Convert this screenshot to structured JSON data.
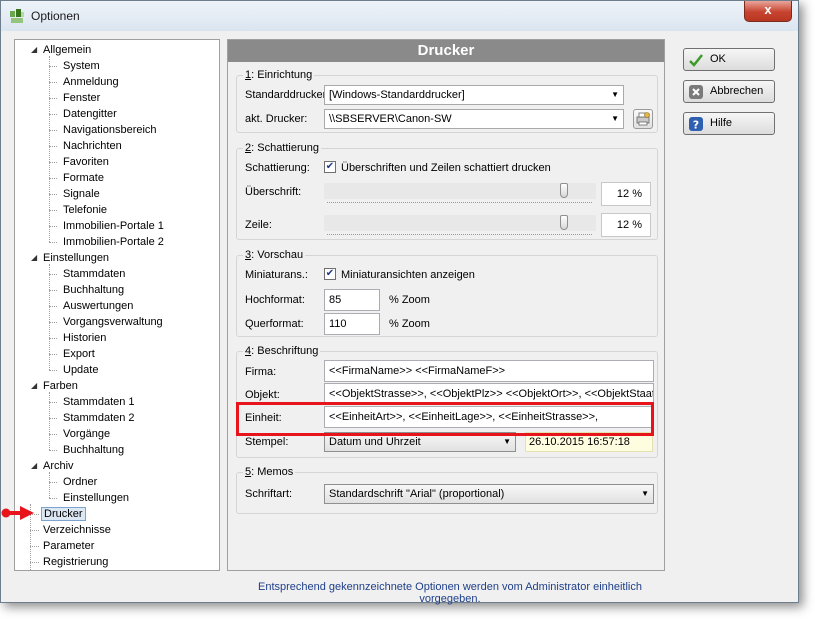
{
  "window": {
    "title": "Optionen",
    "close_label": "x"
  },
  "tree": {
    "items": [
      {
        "label": "Allgemein",
        "level": 0,
        "expander": "◢"
      },
      {
        "label": "System",
        "level": 1
      },
      {
        "label": "Anmeldung",
        "level": 1
      },
      {
        "label": "Fenster",
        "level": 1
      },
      {
        "label": "Datengitter",
        "level": 1
      },
      {
        "label": "Navigationsbereich",
        "level": 1
      },
      {
        "label": "Nachrichten",
        "level": 1
      },
      {
        "label": "Favoriten",
        "level": 1
      },
      {
        "label": "Formate",
        "level": 1
      },
      {
        "label": "Signale",
        "level": 1
      },
      {
        "label": "Telefonie",
        "level": 1
      },
      {
        "label": "Immobilien-Portale 1",
        "level": 1
      },
      {
        "label": "Immobilien-Portale 2",
        "level": 1
      },
      {
        "label": "Einstellungen",
        "level": 0,
        "expander": "◢"
      },
      {
        "label": "Stammdaten",
        "level": 1
      },
      {
        "label": "Buchhaltung",
        "level": 1
      },
      {
        "label": "Auswertungen",
        "level": 1
      },
      {
        "label": "Vorgangsverwaltung",
        "level": 1
      },
      {
        "label": "Historien",
        "level": 1
      },
      {
        "label": "Export",
        "level": 1
      },
      {
        "label": "Update",
        "level": 1
      },
      {
        "label": "Farben",
        "level": 0,
        "expander": "◢"
      },
      {
        "label": "Stammdaten 1",
        "level": 1
      },
      {
        "label": "Stammdaten 2",
        "level": 1
      },
      {
        "label": "Vorgänge",
        "level": 1
      },
      {
        "label": "Buchhaltung",
        "level": 1
      },
      {
        "label": "Archiv",
        "level": 0,
        "expander": "◢"
      },
      {
        "label": "Ordner",
        "level": 1
      },
      {
        "label": "Einstellungen",
        "level": 1
      },
      {
        "label": "Drucker",
        "level": 0,
        "selected": true
      },
      {
        "label": "Verzeichnisse",
        "level": 0
      },
      {
        "label": "Parameter",
        "level": 0
      },
      {
        "label": "Registrierung",
        "level": 0
      }
    ]
  },
  "panel": {
    "title": "Drucker",
    "einrichtung": {
      "title_num": "1",
      "title_rest": ": Einrichtung",
      "standard_label": "Standarddrucker:",
      "standard_value": "[Windows-Standarddrucker]",
      "akt_label": "akt. Drucker:",
      "akt_value": "\\\\SBSERVER\\Canon-SW"
    },
    "schattierung": {
      "title_num": "2",
      "title_rest": ": Schattierung",
      "label": "Schattierung:",
      "checkbox_label": "Überschriften und Zeilen schattiert drucken",
      "ueberschrift_label": "Überschrift:",
      "ueberschrift_value": "12 %",
      "ueberschrift_level": 0.9,
      "zeile_label": "Zeile:",
      "zeile_value": "12 %",
      "zeile_level": 0.9
    },
    "vorschau": {
      "title_num": "3",
      "title_rest": ": Vorschau",
      "miniatur_label": "Miniaturans.:",
      "miniatur_checkbox": "Miniaturansichten anzeigen",
      "hoch_label": "Hochformat:",
      "hoch_value": "85",
      "hoch_unit": "% Zoom",
      "quer_label": "Querformat:",
      "quer_value": "110",
      "quer_unit": "% Zoom"
    },
    "beschriftung": {
      "title_num": "4",
      "title_rest": ": Beschriftung",
      "firma_label": "Firma:",
      "firma_value": "<<FirmaName>> <<FirmaNameF>>",
      "objekt_label": "Objekt:",
      "objekt_value": "<<ObjektStrasse>>, <<ObjektPlz>> <<ObjektOrt>>, <<ObjektStaat>>",
      "einheit_label": "Einheit:",
      "einheit_value": "<<EinheitArt>>, <<EinheitLage>>, <<EinheitStrasse>>,",
      "stempel_label": "Stempel:",
      "stempel_value": "Datum und Uhrzeit",
      "stempel_date": "26.10.2015 16:57:18"
    },
    "memos": {
      "title_num": "5",
      "title_rest": ": Memos",
      "schriftart_label": "Schriftart:",
      "schriftart_value": "Standardschrift \"Arial\" (proportional)"
    }
  },
  "buttons": {
    "ok": "OK",
    "abbrechen": "Abbrechen",
    "hilfe": "Hilfe"
  },
  "footer": "Entsprechend gekennzeichnete Optionen werden vom Administrator einheitlich vorgegeben.",
  "colors": {
    "highlight": "#e8141c",
    "header_bg": "#8a8a8a",
    "footer_text": "#1f3f8a"
  }
}
